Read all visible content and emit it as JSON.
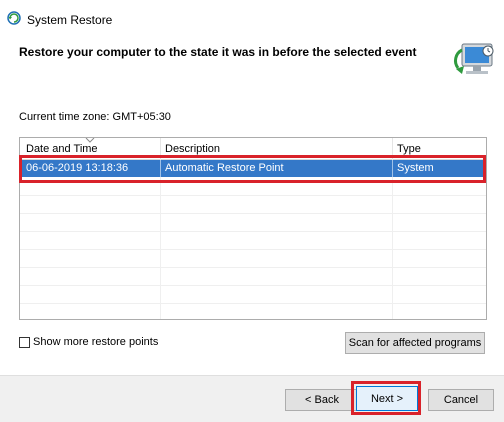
{
  "window": {
    "title": "System Restore",
    "icon": "system-restore-icon"
  },
  "heading": "Restore your computer to the state it was in before the selected event",
  "hero_icon": "restore-computer-icon",
  "timezone_label": "Current time zone: GMT+05:30",
  "table": {
    "columns": [
      "Date and Time",
      "Description",
      "Type"
    ],
    "rows": [
      {
        "date": "06-06-2019 13:18:36",
        "description": "Automatic Restore Point",
        "type": "System",
        "selected": true
      }
    ]
  },
  "show_more_label": "Show more restore points",
  "show_more_checked": false,
  "scan_button": "Scan for affected programs",
  "buttons": {
    "back": "< Back",
    "next": "Next >",
    "cancel": "Cancel"
  },
  "colors": {
    "selection": "#3478c8",
    "highlight_box": "#d9222a",
    "accent": "#0078d7"
  }
}
